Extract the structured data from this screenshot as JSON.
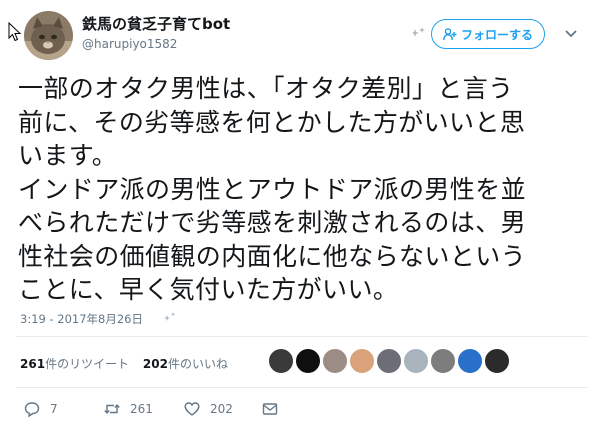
{
  "author": {
    "display_name": "鉄馬の貧乏子育てbot",
    "screen_name": "@harupiyo1582",
    "avatar_icon": "cat-avatar"
  },
  "follow_button": {
    "label": "フォローする",
    "icon": "follow-person-icon",
    "color": "#1da1f2"
  },
  "menu_icon": "chevron-down-icon",
  "tweet": {
    "text": "一部のオタク男性は、「オタク差別」と言う\n前に、その劣等感を何とかした方がいいと思\nいます。\nインドア派の男性とアウトドア派の男性を並\nべられただけで劣等感を刺激されるのは、男\n性社会の価値観の内面化に他ならないという\nことに、早く気付いた方がいい。"
  },
  "timestamp": "3:19 - 2017年8月26日",
  "stats": {
    "retweets_count": "261",
    "retweets_label": "件のリツイート",
    "likes_count": "202",
    "likes_label": "件のいいね"
  },
  "likers": [
    {
      "name": "liker-1",
      "color": "#3a3a3a"
    },
    {
      "name": "liker-2",
      "color": "#0f0f0f"
    },
    {
      "name": "liker-3",
      "color": "#9b8c85"
    },
    {
      "name": "liker-4",
      "color": "#d9a27a"
    },
    {
      "name": "liker-5",
      "color": "#6d6d78"
    },
    {
      "name": "liker-6",
      "color": "#a8b3bd"
    },
    {
      "name": "liker-7",
      "color": "#7d7d7d"
    },
    {
      "name": "liker-8",
      "color": "#2a6fc9"
    },
    {
      "name": "liker-9",
      "color": "#2b2b2b"
    }
  ],
  "actions": {
    "reply_count": "7",
    "retweet_count": "261",
    "like_count": "202"
  },
  "colors": {
    "link": "#1da1f2",
    "secondary_text": "#657786",
    "divider": "#e6ecf0"
  }
}
